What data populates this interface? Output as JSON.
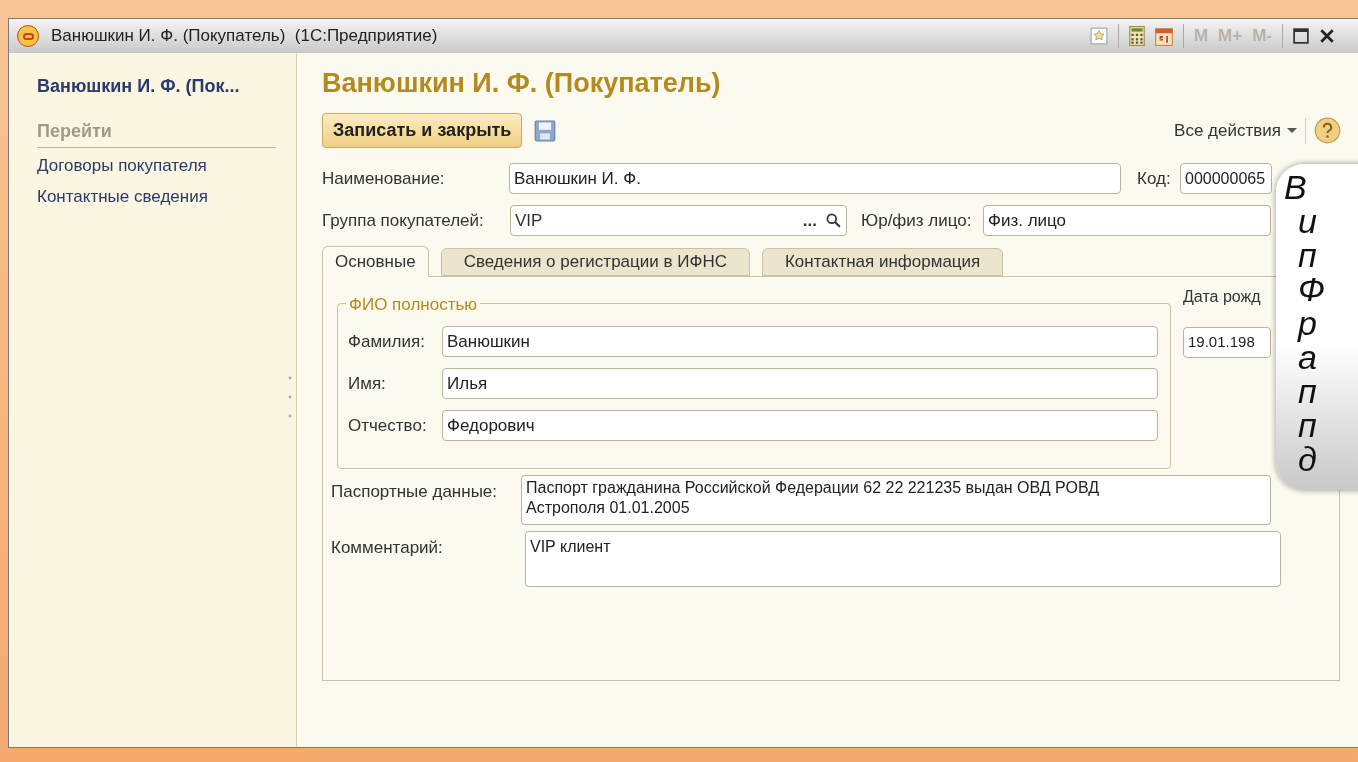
{
  "window": {
    "title": "Ванюшкин И. Ф. (Покупатель)  (1С:Предприятие)",
    "memory_buttons": [
      "M",
      "M+",
      "M-"
    ]
  },
  "sidebar": {
    "title": "Ванюшкин И. Ф. (Пок...",
    "section": "Перейти",
    "items": [
      "Договоры покупателя",
      "Контактные сведения"
    ]
  },
  "form": {
    "title": "Ванюшкин И. Ф. (Покупатель)",
    "save_close_button": "Записать и закрыть",
    "all_actions": "Все действия",
    "name": {
      "label": "Наименование:",
      "value": "Ванюшкин И. Ф."
    },
    "code": {
      "label": "Код:",
      "value": "000000065"
    },
    "group": {
      "label": "Группа покупателей:",
      "value": "VIP",
      "ellipsis": "..."
    },
    "entity_type": {
      "label": "Юр/физ лицо:",
      "value": "Физ. лицо"
    },
    "tabs": [
      {
        "label": "Основные",
        "selected": true
      },
      {
        "label": "Сведения о регистрации в ИФНС",
        "selected": false
      },
      {
        "label": "Контактная информация",
        "selected": false
      }
    ],
    "fio": {
      "legend": "ФИО полностью",
      "fields": [
        {
          "label": "Фамилия:",
          "value": "Ванюшкин"
        },
        {
          "label": "Имя:",
          "value": "Илья"
        },
        {
          "label": "Отчество:",
          "value": "Федорович"
        }
      ]
    },
    "birth_date": {
      "label": "Дата рожд",
      "value": "19.01.198"
    },
    "passport": {
      "label": "Паспортные данные:",
      "lines": [
        "Паспорт гражданина Российской Федерации 62 22 221235 выдан ОВД РОВД",
        "Астрополя 01.01.2005"
      ]
    },
    "comment": {
      "label": "Комментарий:",
      "value": "VIP клиент"
    }
  },
  "callout": {
    "lines": [
      "В",
      "и",
      "п",
      "Ф",
      "р",
      "а",
      "п",
      "п",
      "д"
    ]
  }
}
